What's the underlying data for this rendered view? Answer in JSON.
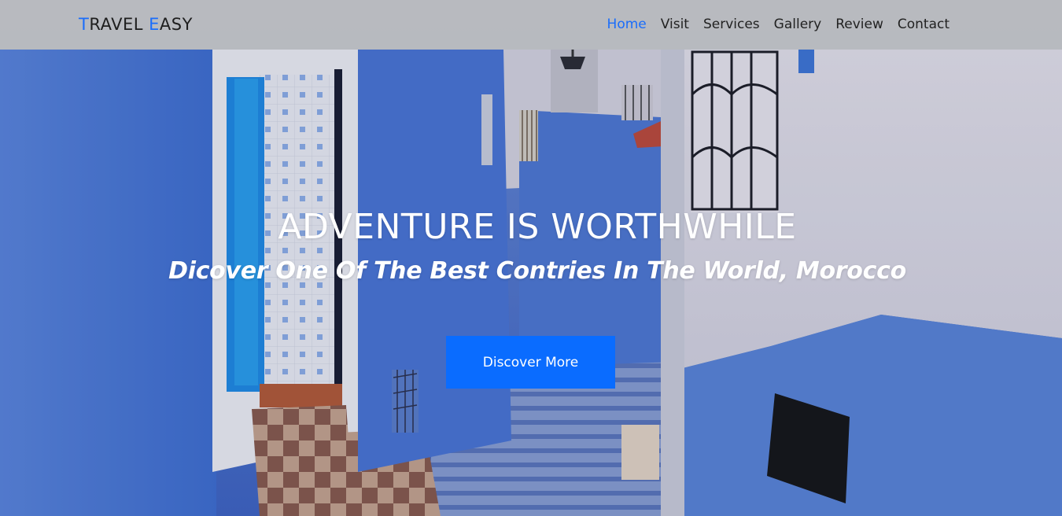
{
  "brand": {
    "part1_initial": "T",
    "part1_rest": "RAVEL ",
    "part2_initial": "E",
    "part2_rest": "ASY"
  },
  "nav": {
    "items": [
      {
        "label": "Home",
        "active": true
      },
      {
        "label": "Visit",
        "active": false
      },
      {
        "label": "Services",
        "active": false
      },
      {
        "label": "Gallery",
        "active": false
      },
      {
        "label": "Review",
        "active": false
      },
      {
        "label": "Contact",
        "active": false
      }
    ]
  },
  "hero": {
    "title": "ADVENTURE IS WORTHWHILE",
    "subtitle": "Dicover One Of The Best Contries In The World, Morocco",
    "cta_label": "Discover More"
  },
  "colors": {
    "accent": "#1a6dfb",
    "button": "#0a6cff",
    "navbar_bg": "#bebebe",
    "wall_blue": "#4a78d6"
  }
}
